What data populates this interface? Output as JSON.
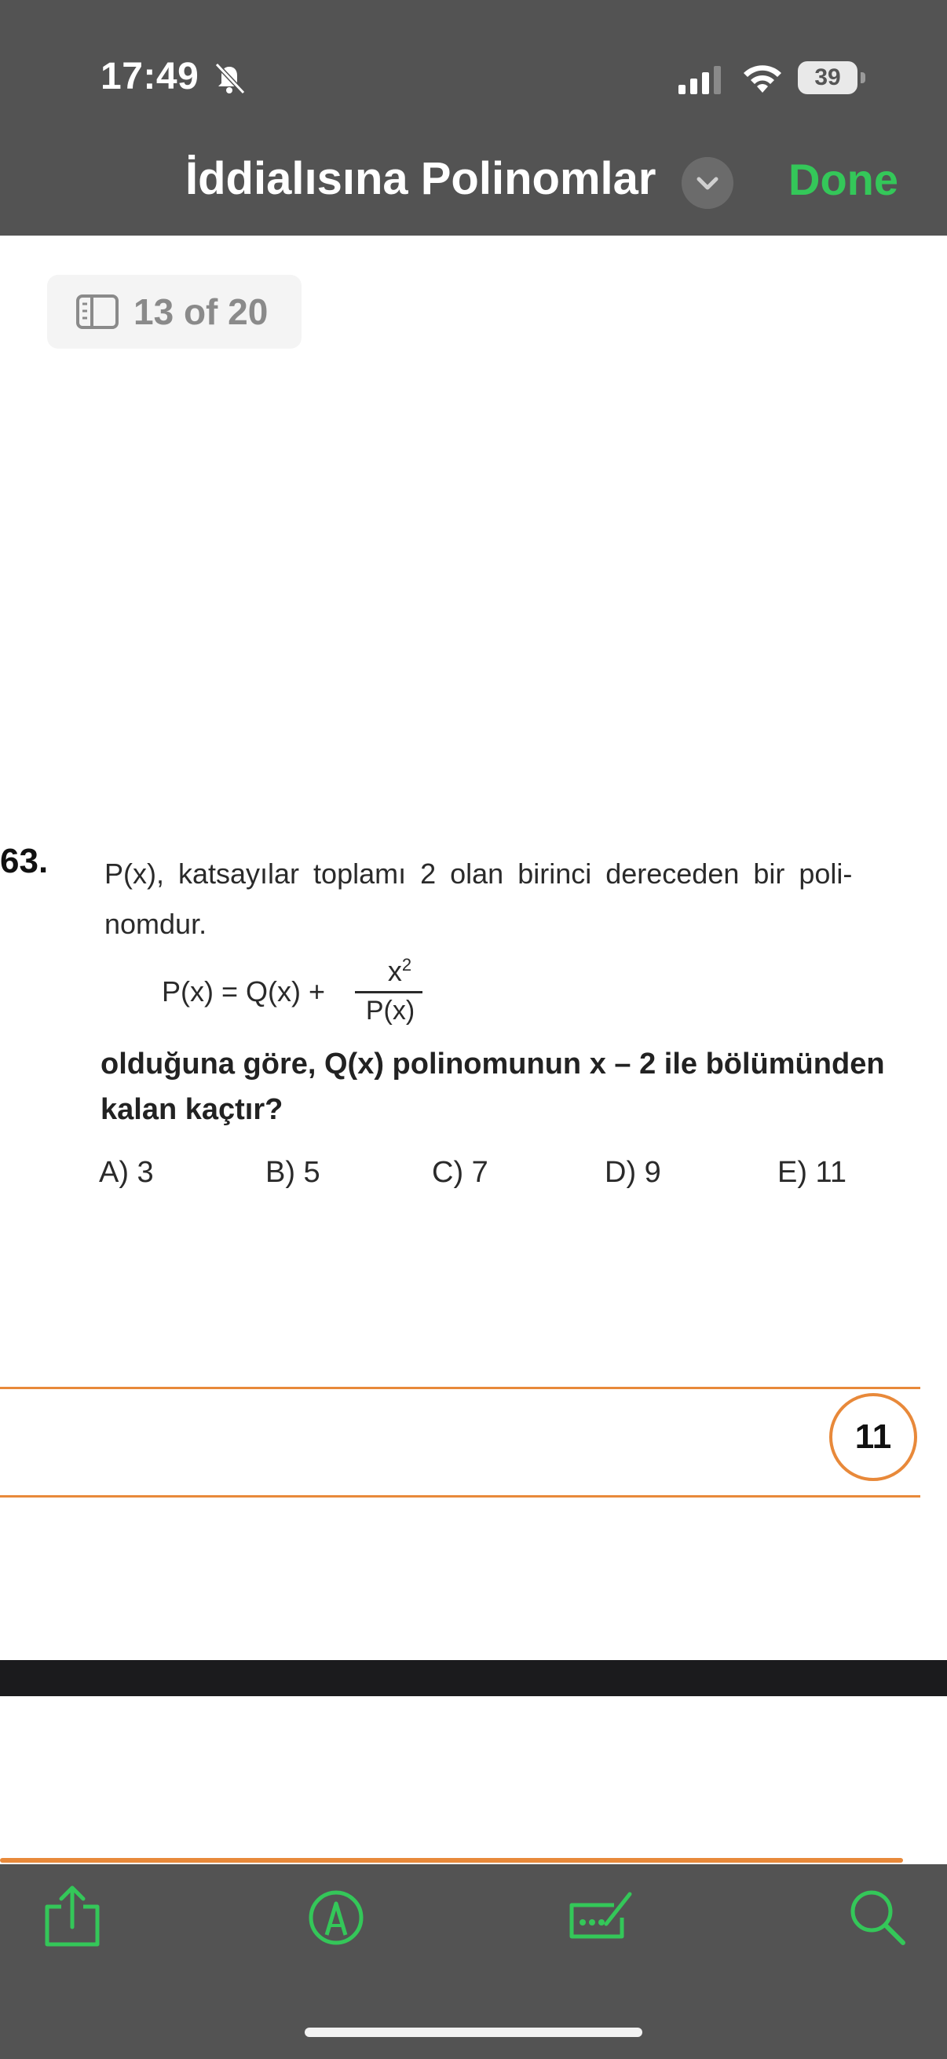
{
  "status_bar": {
    "time": "17:49",
    "battery_level": "39",
    "icons": [
      "bell-slash-icon",
      "signal-icon",
      "wifi-icon",
      "battery-icon"
    ]
  },
  "header": {
    "title": "İddialısına Polinomlar",
    "done_label": "Done",
    "accent_color": "#34c759"
  },
  "page_indicator": {
    "text": "13 of 20",
    "icon": "sidebar-icon"
  },
  "question": {
    "number": "63.",
    "line1": "P(x), katsayılar toplamı 2 olan birinci dereceden bir poli-",
    "line2": "nomdur.",
    "equation_left": "P(x) = Q(x) +",
    "equation_numerator": "x",
    "equation_exponent": "2",
    "equation_denominator": "P(x)",
    "prompt_line1": "olduğuna göre, Q(x) polinomunun x – 2 ile bölümünden",
    "prompt_line2": "kalan kaçtır?",
    "options": [
      "A) 3",
      "B) 5",
      "C) 7",
      "D) 9",
      "E) 11"
    ]
  },
  "page_footer": {
    "page_number": "11",
    "accent_color": "#e8893a"
  },
  "toolbar": {
    "items": [
      "share-icon",
      "markup-icon",
      "form-fill-icon",
      "search-icon"
    ],
    "color": "#34c759"
  }
}
